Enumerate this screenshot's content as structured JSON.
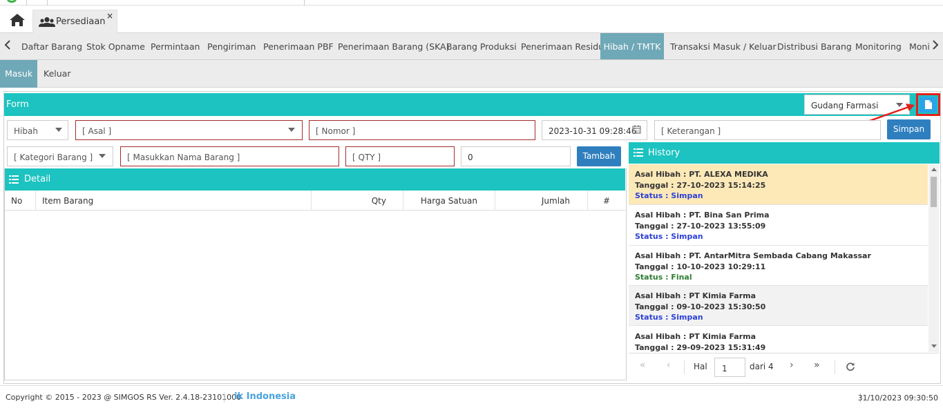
{
  "app_tab": {
    "label": "Persediaan",
    "close": "×"
  },
  "menu": {
    "items": [
      "Daftar Barang",
      "Stok Opname",
      "Permintaan",
      "Pengiriman",
      "Penerimaan PBF",
      "Penerimaan Barang (SKA)",
      "Barang Produksi",
      "Penerimaan Residu",
      "Hibah / TMTK",
      "Transaksi Masuk / Keluar",
      "Distribusi Barang",
      "Monitoring",
      "Moni"
    ],
    "active": "Hibah / TMTK"
  },
  "submenu": {
    "items": [
      "Masuk",
      "Keluar"
    ],
    "active": "Masuk"
  },
  "form": {
    "title": "Form",
    "warehouse": "Gudang Farmasi",
    "type_select": "Hibah",
    "asal_placeholder": "[ Asal ]",
    "nomor_placeholder": "[ Nomor ]",
    "datetime": "2023-10-31 09:28:46",
    "keterangan_placeholder": "[ Keterangan ]",
    "simpan_label": "Simpan",
    "kategori_placeholder": "[ Kategori Barang ]",
    "nama_barang_placeholder": "[ Masukkan Nama Barang ]",
    "qty_placeholder": "[ QTY ]",
    "harga_value": "0",
    "tambah_label": "Tambah"
  },
  "detail": {
    "title": "Detail",
    "columns": [
      "No",
      "Item Barang",
      "Qty",
      "Harga Satuan",
      "Jumlah",
      "#"
    ]
  },
  "history": {
    "title": "History",
    "items": [
      {
        "asal": "Asal Hibah : PT. ALEXA MEDIKA",
        "tanggal": "Tanggal : 27-10-2023 15:14:25",
        "status": "Status : Simpan",
        "status_kind": "blue",
        "highlight": true
      },
      {
        "asal": "Asal Hibah : PT. Bina San Prima",
        "tanggal": "Tanggal : 27-10-2023 13:55:09",
        "status": "Status : Simpan",
        "status_kind": "blue",
        "highlight": false
      },
      {
        "asal": "Asal Hibah : PT. AntarMitra Sembada Cabang Makassar",
        "tanggal": "Tanggal : 10-10-2023 10:29:11",
        "status": "Status : Final",
        "status_kind": "green",
        "highlight": false
      },
      {
        "asal": "Asal Hibah : PT Kimia Farma",
        "tanggal": "Tanggal : 09-10-2023 15:30:50",
        "status": "Status : Simpan",
        "status_kind": "blue",
        "highlight": false
      },
      {
        "asal": "Asal Hibah : PT Kimia Farma",
        "tanggal": "Tanggal : 29-09-2023 15:31:49",
        "status": "",
        "status_kind": "blue",
        "highlight": false
      }
    ],
    "pager": {
      "hal_label": "Hal",
      "page": "1",
      "dari": "dari 4"
    }
  },
  "footer": {
    "copyright": "Copyright © 2015 - 2023 @ SIMGOS RS Ver. 2.4.18-23101000",
    "brand": "ik Indonesia",
    "datetime": "31/10/2023 09:30:50"
  },
  "colors": {
    "teal": "#1cc3c0",
    "active_tab": "#6fa8b7",
    "button": "#2f7fbf",
    "annotation_red": "#e3201b"
  }
}
